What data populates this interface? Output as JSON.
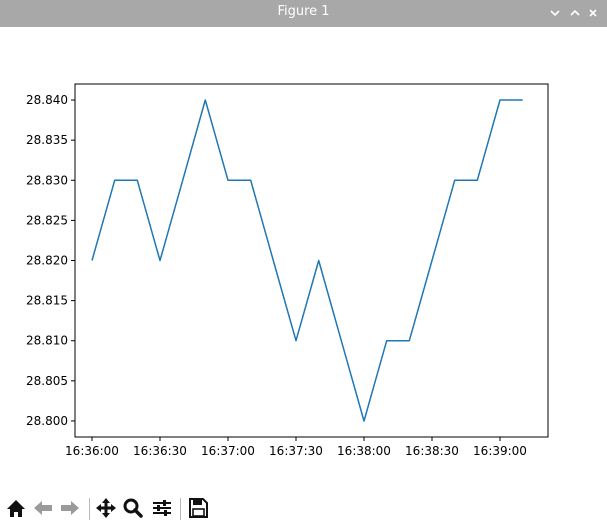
{
  "window": {
    "title": "Figure 1",
    "controls": [
      "minimize",
      "maximize",
      "close"
    ]
  },
  "toolbar": {
    "tools": [
      "home-icon",
      "back-icon",
      "forward-icon",
      "pan-icon",
      "zoom-icon",
      "configure-subplots-icon",
      "save-icon"
    ]
  },
  "chart_data": {
    "type": "line",
    "title": "",
    "xlabel": "",
    "ylabel": "",
    "x": [
      "16:36:00",
      "16:36:10",
      "16:36:20",
      "16:36:30",
      "16:36:40",
      "16:36:50",
      "16:37:00",
      "16:37:10",
      "16:37:20",
      "16:37:30",
      "16:37:40",
      "16:37:50",
      "16:38:00",
      "16:38:10",
      "16:38:20",
      "16:38:30",
      "16:38:40",
      "16:38:50",
      "16:39:00",
      "16:39:10"
    ],
    "series": [
      {
        "color": "#1f77b4",
        "values": [
          28.82,
          28.83,
          28.83,
          28.82,
          28.83,
          28.84,
          28.83,
          28.83,
          28.82,
          28.81,
          28.82,
          28.81,
          28.8,
          28.81,
          28.81,
          28.82,
          28.83,
          28.83,
          28.84,
          28.84
        ]
      }
    ],
    "xticks": [
      "16:36:00",
      "16:36:30",
      "16:37:00",
      "16:37:30",
      "16:38:00",
      "16:38:30",
      "16:39:00"
    ],
    "yticks": [
      "28.800",
      "28.805",
      "28.810",
      "28.815",
      "28.820",
      "28.825",
      "28.830",
      "28.835",
      "28.840"
    ],
    "ylim": [
      28.798,
      28.842
    ],
    "grid": false,
    "legend": "none"
  }
}
